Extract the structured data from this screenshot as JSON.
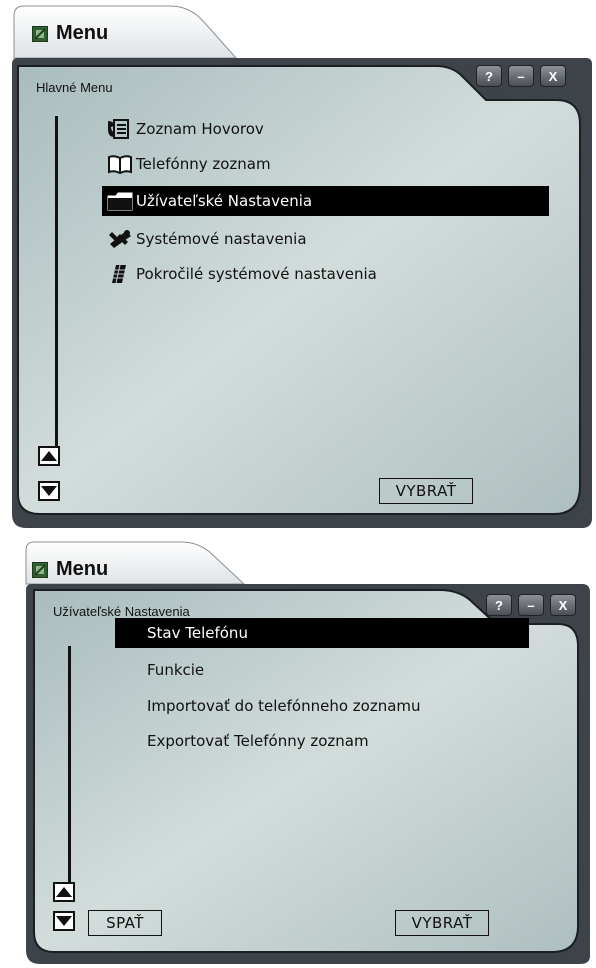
{
  "windows": [
    {
      "app_title": "Menu",
      "breadcrumb": "Hlavné Menu",
      "controls": {
        "help": "?",
        "minimize": "–",
        "close": "X"
      },
      "items": [
        {
          "label": "Zoznam Hovorov",
          "icon": "call-log-icon",
          "selected": false
        },
        {
          "label": "Telefónny zoznam",
          "icon": "book-icon",
          "selected": false
        },
        {
          "label": "Užívateľské Nastavenia",
          "icon": "folder-icon",
          "selected": true
        },
        {
          "label": "Systémové nastavenia",
          "icon": "tools-icon",
          "selected": false
        },
        {
          "label": "Pokročilé systémové nastavenia",
          "icon": "keypad-icon",
          "selected": false
        }
      ],
      "softkey_right": "VYBRAŤ"
    },
    {
      "app_title": "Menu",
      "breadcrumb": "Užívateľské Nastavenia",
      "controls": {
        "help": "?",
        "minimize": "–",
        "close": "X"
      },
      "items": [
        {
          "label": "Stav Telefónu",
          "selected": true
        },
        {
          "label": "Funkcie",
          "selected": false
        },
        {
          "label": "Importovať do telefónneho zoznamu",
          "selected": false
        },
        {
          "label": "Exportovať Telefónny zoznam",
          "selected": false
        }
      ],
      "softkey_left": "SPAŤ",
      "softkey_right": "VYBRAŤ"
    }
  ],
  "colors": {
    "screen": "#b9c9c9",
    "frame": "#3d4248",
    "selection": "#000000"
  }
}
